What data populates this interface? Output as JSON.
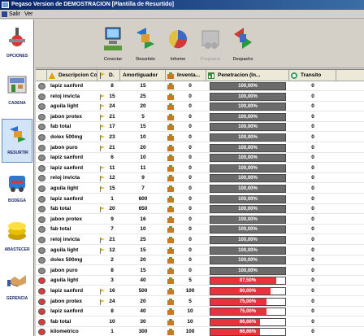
{
  "window": {
    "title": "Pegaso Version de DEMOSTRACION   [Plantilla de Resurtido]"
  },
  "menu": [
    {
      "label": "Salir"
    },
    {
      "label": "Ver"
    }
  ],
  "sidebar": [
    {
      "label": "OPCIONES",
      "icon": "options-icon"
    },
    {
      "label": "CADENA",
      "icon": "store-icon"
    },
    {
      "label": "RESURTIR",
      "icon": "restock-icon"
    },
    {
      "label": "BODEGA",
      "icon": "warehouse-icon"
    },
    {
      "label": "ABASTECER",
      "icon": "coins-icon"
    },
    {
      "label": "GERENCIA",
      "icon": "handshake-icon"
    }
  ],
  "toolbar": [
    {
      "label": "Conectar",
      "icon": "connect-icon",
      "enabled": true
    },
    {
      "label": "Resurtido",
      "icon": "restock-arrows-icon",
      "enabled": true
    },
    {
      "label": "Informe",
      "icon": "report-icon",
      "enabled": true
    },
    {
      "label": "Programa",
      "icon": "schedule-icon",
      "enabled": false
    },
    {
      "label": "Despacho",
      "icon": "dispatch-icon",
      "enabled": true
    }
  ],
  "columns": [
    {
      "label": ""
    },
    {
      "label": "Descripcion Corta"
    },
    {
      "label": "D."
    },
    {
      "label": "Amortiguador"
    },
    {
      "label": "Inventa..."
    },
    {
      "label": "Penetracion (In..."
    },
    {
      "label": "Transito"
    }
  ],
  "rows": [
    {
      "status": "gray",
      "desc": "lapiz sanford",
      "flag": false,
      "d": "8",
      "amort": "15",
      "inv": "0",
      "pen": "100,00%",
      "pen_level": 1.0,
      "pen_color": "#6b6b6b",
      "transit": "0"
    },
    {
      "status": "gray",
      "desc": "reloj invicta",
      "flag": true,
      "d": "15",
      "amort": "25",
      "inv": "0",
      "pen": "100,00%",
      "pen_level": 1.0,
      "pen_color": "#6b6b6b",
      "transit": "0"
    },
    {
      "status": "gray",
      "desc": "aguila light",
      "flag": true,
      "d": "24",
      "amort": "20",
      "inv": "0",
      "pen": "100,00%",
      "pen_level": 1.0,
      "pen_color": "#6b6b6b",
      "transit": "0"
    },
    {
      "status": "gray",
      "desc": "jabon protex",
      "flag": true,
      "d": "21",
      "amort": "5",
      "inv": "0",
      "pen": "100,00%",
      "pen_level": 1.0,
      "pen_color": "#6b6b6b",
      "transit": "0"
    },
    {
      "status": "gray",
      "desc": "fab total",
      "flag": true,
      "d": "17",
      "amort": "15",
      "inv": "0",
      "pen": "100,00%",
      "pen_level": 1.0,
      "pen_color": "#6b6b6b",
      "transit": "0"
    },
    {
      "status": "gray",
      "desc": "dolex 500mg",
      "flag": true,
      "d": "23",
      "amort": "10",
      "inv": "0",
      "pen": "100,00%",
      "pen_level": 1.0,
      "pen_color": "#6b6b6b",
      "transit": "0"
    },
    {
      "status": "gray",
      "desc": "jabon puro",
      "flag": true,
      "d": "21",
      "amort": "20",
      "inv": "0",
      "pen": "100,00%",
      "pen_level": 1.0,
      "pen_color": "#6b6b6b",
      "transit": "0"
    },
    {
      "status": "gray",
      "desc": "lapiz sanford",
      "flag": false,
      "d": "6",
      "amort": "10",
      "inv": "0",
      "pen": "100,00%",
      "pen_level": 1.0,
      "pen_color": "#6b6b6b",
      "transit": "0"
    },
    {
      "status": "gray",
      "desc": "lapiz sanford",
      "flag": true,
      "d": "11",
      "amort": "11",
      "inv": "0",
      "pen": "100,00%",
      "pen_level": 1.0,
      "pen_color": "#6b6b6b",
      "transit": "0"
    },
    {
      "status": "gray",
      "desc": "reloj invicta",
      "flag": true,
      "d": "12",
      "amort": "9",
      "inv": "0",
      "pen": "100,00%",
      "pen_level": 1.0,
      "pen_color": "#6b6b6b",
      "transit": "0"
    },
    {
      "status": "gray",
      "desc": "aguila light",
      "flag": true,
      "d": "15",
      "amort": "7",
      "inv": "0",
      "pen": "100,00%",
      "pen_level": 1.0,
      "pen_color": "#6b6b6b",
      "transit": "0"
    },
    {
      "status": "gray",
      "desc": "lapiz sanford",
      "flag": false,
      "d": "1",
      "amort": "600",
      "inv": "0",
      "pen": "100,00%",
      "pen_level": 1.0,
      "pen_color": "#6b6b6b",
      "transit": "0"
    },
    {
      "status": "gray",
      "desc": "fab total",
      "flag": true,
      "d": "20",
      "amort": "650",
      "inv": "0",
      "pen": "100,00%",
      "pen_level": 1.0,
      "pen_color": "#6b6b6b",
      "transit": "0"
    },
    {
      "status": "gray",
      "desc": "jabon protex",
      "flag": false,
      "d": "9",
      "amort": "16",
      "inv": "0",
      "pen": "100,00%",
      "pen_level": 1.0,
      "pen_color": "#6b6b6b",
      "transit": "0"
    },
    {
      "status": "gray",
      "desc": "fab total",
      "flag": false,
      "d": "7",
      "amort": "10",
      "inv": "0",
      "pen": "100,00%",
      "pen_level": 1.0,
      "pen_color": "#6b6b6b",
      "transit": "0"
    },
    {
      "status": "gray",
      "desc": "reloj invicta",
      "flag": true,
      "d": "21",
      "amort": "25",
      "inv": "0",
      "pen": "100,00%",
      "pen_level": 1.0,
      "pen_color": "#6b6b6b",
      "transit": "0"
    },
    {
      "status": "gray",
      "desc": "aguila light",
      "flag": true,
      "d": "12",
      "amort": "15",
      "inv": "0",
      "pen": "100,00%",
      "pen_level": 1.0,
      "pen_color": "#6b6b6b",
      "transit": "0"
    },
    {
      "status": "gray",
      "desc": "dolex 500mg",
      "flag": false,
      "d": "2",
      "amort": "20",
      "inv": "0",
      "pen": "100,00%",
      "pen_level": 1.0,
      "pen_color": "#6b6b6b",
      "transit": "0"
    },
    {
      "status": "gray",
      "desc": "jabon puro",
      "flag": false,
      "d": "8",
      "amort": "15",
      "inv": "0",
      "pen": "100,00%",
      "pen_level": 1.0,
      "pen_color": "#6b6b6b",
      "transit": "0"
    },
    {
      "status": "red",
      "desc": "aguila light",
      "flag": false,
      "d": "3",
      "amort": "40",
      "inv": "5",
      "pen": "87,50%",
      "pen_level": 0.875,
      "pen_color": "#e8323c",
      "transit": "0"
    },
    {
      "status": "red",
      "desc": "lapiz sanford",
      "flag": true,
      "d": "16",
      "amort": "500",
      "inv": "100",
      "pen": "80,00%",
      "pen_level": 0.8,
      "pen_color": "#e8323c",
      "transit": "0"
    },
    {
      "status": "red",
      "desc": "jabon protex",
      "flag": true,
      "d": "24",
      "amort": "20",
      "inv": "5",
      "pen": "75,00%",
      "pen_level": 0.75,
      "pen_color": "#e8323c",
      "transit": "0"
    },
    {
      "status": "red",
      "desc": "lapiz sanford",
      "flag": false,
      "d": "8",
      "amort": "40",
      "inv": "10",
      "pen": "75,00%",
      "pen_level": 0.75,
      "pen_color": "#e8323c",
      "transit": "0"
    },
    {
      "status": "red",
      "desc": "fab total",
      "flag": false,
      "d": "10",
      "amort": "30",
      "inv": "10",
      "pen": "66,66%",
      "pen_level": 0.6666,
      "pen_color": "#e8323c",
      "transit": "0"
    },
    {
      "status": "red",
      "desc": "kilometrico",
      "flag": false,
      "d": "1",
      "amort": "300",
      "inv": "100",
      "pen": "66,66%",
      "pen_level": 0.6666,
      "pen_color": "#e8323c",
      "transit": "0"
    }
  ]
}
